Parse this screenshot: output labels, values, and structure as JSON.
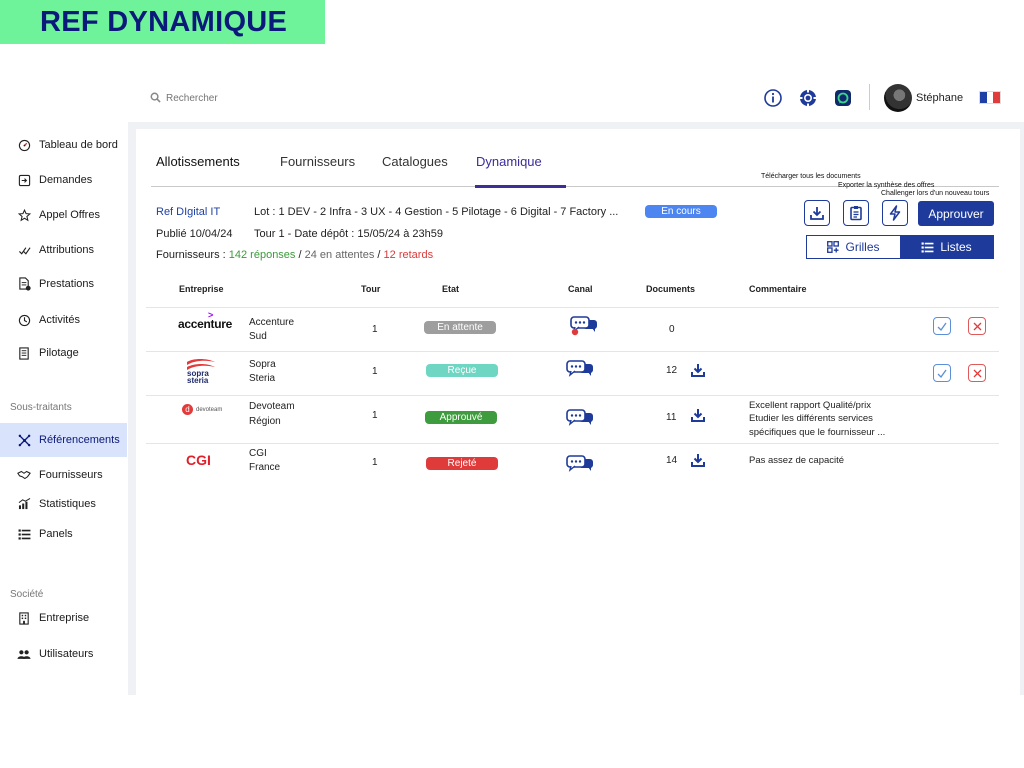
{
  "banner": {
    "title": "REF DYNAMIQUE"
  },
  "topbar": {
    "search_placeholder": "Rechercher",
    "user_name": "Stéphane",
    "flag_colors": [
      "#1d3fa6",
      "#ffffff",
      "#e23b3b"
    ]
  },
  "sidebar": {
    "items": [
      {
        "label": "Tableau de bord",
        "icon": "dashboard-gauge-icon"
      },
      {
        "label": "Demandes",
        "icon": "inbox-icon"
      },
      {
        "label": "Appel Offres",
        "icon": "star-icon"
      },
      {
        "label": "Attributions",
        "icon": "check-icon"
      },
      {
        "label": "Prestations",
        "icon": "document-check-icon"
      },
      {
        "label": "Activités",
        "icon": "activity-icon"
      },
      {
        "label": "Pilotage",
        "icon": "report-icon"
      }
    ],
    "section_subcontractors": "Sous-traitants",
    "sub_items": [
      {
        "label": "Référencements",
        "icon": "network-icon"
      },
      {
        "label": "Fournisseurs",
        "icon": "handshake-icon"
      },
      {
        "label": "Statistiques",
        "icon": "chart-icon"
      },
      {
        "label": "Panels",
        "icon": "list-icon"
      }
    ],
    "section_company": "Société",
    "company_items": [
      {
        "label": "Entreprise",
        "icon": "building-icon"
      },
      {
        "label": "Utilisateurs",
        "icon": "users-icon"
      }
    ]
  },
  "tabs": [
    "Allotissements",
    "Fournisseurs",
    "Catalogues",
    "Dynamique"
  ],
  "info": {
    "ref": "Ref DIgital IT",
    "lots": "Lot : 1 DEV - 2 Infra - 3 UX - 4 Gestion - 5 Pilotage - 6 Digital - 7 Factory ...",
    "status": "En cours",
    "published": "Publié 10/04/24",
    "round": "Tour 1 - Date dépôt : 15/05/24 à 23h59",
    "suppliers_label": "Fournisseurs :",
    "responses": "142 réponses",
    "sep1": "/",
    "waiting": "24 en attentes",
    "sep2": "/",
    "late": "12 retards"
  },
  "tooltips": {
    "download_all": "Télécharger tous les documents",
    "export": "Exporter la synthèse des offres",
    "challenge": "Challenger lors d'un nouveau tours"
  },
  "actions": {
    "approve": "Approuver"
  },
  "view_toggle": {
    "grid": "Grilles",
    "list": "Listes"
  },
  "table": {
    "headers": {
      "company": "Entreprise",
      "round": "Tour",
      "state": "Etat",
      "channel": "Canal",
      "documents": "Documents",
      "comment": "Commentaire"
    },
    "rows": [
      {
        "logo": "accenture",
        "name1": "Accenture",
        "name2": "Sud",
        "round": "1",
        "state": "En attente",
        "state_color": "#9e9e9e",
        "docs": "0",
        "comment1": "",
        "comment2": "",
        "comment3": ""
      },
      {
        "logo": "sopra steria",
        "name1": "Sopra",
        "name2": "Steria",
        "round": "1",
        "state": "Reçue",
        "state_color": "#6fd6c3",
        "docs": "12",
        "comment1": "",
        "comment2": "",
        "comment3": ""
      },
      {
        "logo": "devoteam",
        "name1": "Devoteam",
        "name2": "Région",
        "round": "1",
        "state": "Approuvé",
        "state_color": "#3e9c3e",
        "docs": "11",
        "comment1": "Excellent rapport Qualité/prix",
        "comment2": "Etudier les différents services",
        "comment3": "spécifiques que le fournisseur ..."
      },
      {
        "logo": "CGI",
        "name1": "CGI",
        "name2": "France",
        "round": "1",
        "state": "Rejeté",
        "state_color": "#e03b3b",
        "docs": "14",
        "comment1": "Pas assez de capacité",
        "comment2": "",
        "comment3": ""
      }
    ]
  }
}
